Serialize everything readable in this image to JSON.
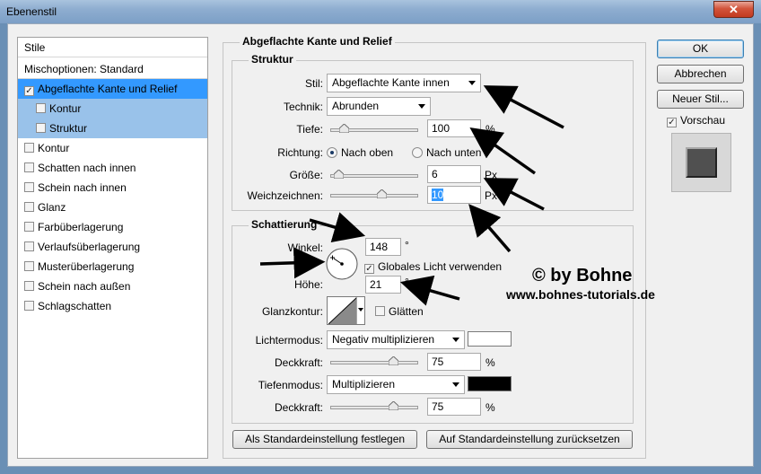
{
  "window": {
    "title": "Ebenenstil",
    "close": "✕"
  },
  "stylelist": {
    "header": "Stile",
    "items": [
      {
        "label": "Mischoptionen: Standard",
        "checkbox": false,
        "checked": false
      },
      {
        "label": "Abgeflachte Kante und Relief",
        "checkbox": true,
        "checked": true,
        "selected": true
      },
      {
        "label": "Kontur",
        "checkbox": true,
        "checked": false,
        "sub": true
      },
      {
        "label": "Struktur",
        "checkbox": true,
        "checked": false,
        "sub": true
      },
      {
        "label": "Kontur",
        "checkbox": true,
        "checked": false
      },
      {
        "label": "Schatten nach innen",
        "checkbox": true,
        "checked": false
      },
      {
        "label": "Schein nach innen",
        "checkbox": true,
        "checked": false
      },
      {
        "label": "Glanz",
        "checkbox": true,
        "checked": false
      },
      {
        "label": "Farbüberlagerung",
        "checkbox": true,
        "checked": false
      },
      {
        "label": "Verlaufsüberlagerung",
        "checkbox": true,
        "checked": false
      },
      {
        "label": "Musterüberlagerung",
        "checkbox": true,
        "checked": false
      },
      {
        "label": "Schein nach außen",
        "checkbox": true,
        "checked": false
      },
      {
        "label": "Schlagschatten",
        "checkbox": true,
        "checked": false
      }
    ]
  },
  "panel": {
    "title": "Abgeflachte Kante und Relief",
    "struktur": {
      "title": "Struktur",
      "stil_label": "Stil:",
      "stil_value": "Abgeflachte Kante innen",
      "technik_label": "Technik:",
      "technik_value": "Abrunden",
      "tiefe_label": "Tiefe:",
      "tiefe_value": "100",
      "tiefe_unit": "%",
      "tiefe_slider": 0.1,
      "richtung_label": "Richtung:",
      "richtung_up": "Nach oben",
      "richtung_down": "Nach unten",
      "groesse_label": "Größe:",
      "groesse_value": "6",
      "groesse_unit": "Px",
      "groesse_slider": 0.03,
      "weich_label": "Weichzeichnen:",
      "weich_value": "10",
      "weich_unit": "Px",
      "weich_slider": 0.6
    },
    "schattierung": {
      "title": "Schattierung",
      "winkel_label": "Winkel:",
      "winkel_value": "148",
      "winkel_unit": "°",
      "global_light": "Globales Licht verwenden",
      "hoehe_label": "Höhe:",
      "hoehe_value": "21",
      "hoehe_unit": "°",
      "glanzkontur_label": "Glanzkontur:",
      "glaetten": "Glätten",
      "licht_label": "Lichtermodus:",
      "licht_value": "Negativ multiplizieren",
      "licht_color": "#ffffff",
      "deck1_label": "Deckkraft:",
      "deck1_value": "75",
      "deck1_unit": "%",
      "deck1_slider": 0.75,
      "tiefen_label": "Tiefenmodus:",
      "tiefen_value": "Multiplizieren",
      "tiefen_color": "#000000",
      "deck2_label": "Deckkraft:",
      "deck2_value": "75",
      "deck2_unit": "%",
      "deck2_slider": 0.75
    },
    "btn_set_default": "Als Standardeinstellung festlegen",
    "btn_reset_default": "Auf Standardeinstellung zurücksetzen"
  },
  "buttons": {
    "ok": "OK",
    "cancel": "Abbrechen",
    "new_style": "Neuer Stil...",
    "preview": "Vorschau"
  },
  "watermark": {
    "line1": "© by Bohne",
    "line2": "www.bohnes-tutorials.de"
  }
}
